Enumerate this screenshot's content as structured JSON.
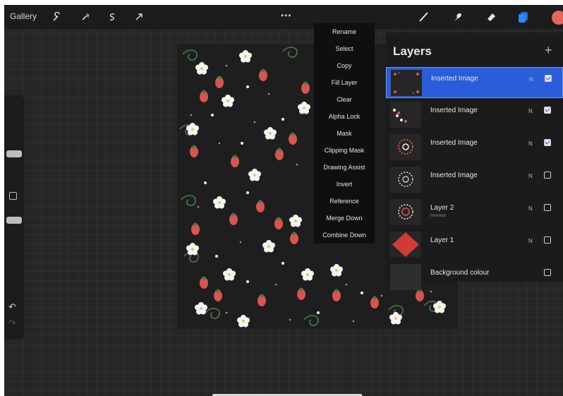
{
  "topbar": {
    "gallery_label": "Gallery",
    "left_tools": [
      "wrench-icon",
      "magic-wand-icon",
      "selection-icon",
      "transform-arrow-icon"
    ],
    "right_tools": [
      "brush-icon",
      "smudge-icon",
      "eraser-icon",
      "layers-icon"
    ],
    "more_label": "•••",
    "current_color": "#e8645a"
  },
  "sidebar": {
    "undo_glyph": "↶",
    "redo_glyph": "↷"
  },
  "layer_menu": {
    "items": [
      "Rename",
      "Select",
      "Copy",
      "Fill Layer",
      "Clear",
      "Alpha Lock",
      "Mask",
      "Clipping Mask",
      "Drawing Assist",
      "Invert",
      "Reference",
      "Merge Down",
      "Combine Down"
    ]
  },
  "layers_panel": {
    "title": "Layers",
    "add_label": "+",
    "layers": [
      {
        "name": "Inserted Image",
        "sub": "",
        "mode": "N",
        "visible": true,
        "selected": true
      },
      {
        "name": "Inserted Image",
        "sub": "",
        "mode": "N",
        "visible": true,
        "selected": false
      },
      {
        "name": "Inserted Image",
        "sub": "",
        "mode": "N",
        "visible": true,
        "selected": false
      },
      {
        "name": "Inserted Image",
        "sub": "",
        "mode": "N",
        "visible": false,
        "selected": false
      },
      {
        "name": "Layer 2",
        "sub": "Inverted",
        "mode": "N",
        "visible": false,
        "selected": false
      },
      {
        "name": "Layer 1",
        "sub": "",
        "mode": "N",
        "visible": false,
        "selected": false
      },
      {
        "name": "Background colour",
        "sub": "",
        "mode": "",
        "visible": false,
        "selected": false
      }
    ]
  }
}
